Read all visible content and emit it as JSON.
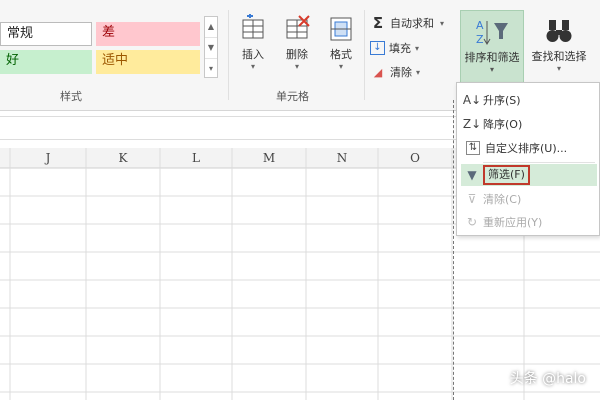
{
  "cell_styles": {
    "normal": "常规",
    "bad": "差",
    "good": "好",
    "neutral": "适中",
    "group_label": "样式"
  },
  "cells_group": {
    "insert": "插入",
    "delete": "删除",
    "format": "格式",
    "group_label": "单元格"
  },
  "editing_group": {
    "autosum": "自动求和",
    "fill": "填充",
    "clear": "清除",
    "sort_filter": "排序和筛选",
    "find_select": "查找和选择"
  },
  "columns": [
    "J",
    "K",
    "L",
    "M",
    "N",
    "O"
  ],
  "sort_menu": {
    "items": [
      {
        "label": "升序(S)",
        "icon": "sort-ascending-icon",
        "enabled": true
      },
      {
        "label": "降序(O)",
        "icon": "sort-descending-icon",
        "enabled": true
      },
      {
        "label": "自定义排序(U)...",
        "icon": "custom-sort-icon",
        "enabled": true
      },
      {
        "label": "筛选(F)",
        "icon": "filter-icon",
        "enabled": true,
        "highlighted": true
      },
      {
        "label": "清除(C)",
        "icon": "clear-filter-icon",
        "enabled": false
      },
      {
        "label": "重新应用(Y)",
        "icon": "reapply-icon",
        "enabled": false
      }
    ]
  },
  "watermark": "头条 @halo",
  "colors": {
    "good_bg": "#c6efce",
    "bad_bg": "#ffc7ce",
    "neutral_bg": "#ffeb9c",
    "active_button": "#c9e3cf",
    "filter_box": "#c0392b"
  }
}
